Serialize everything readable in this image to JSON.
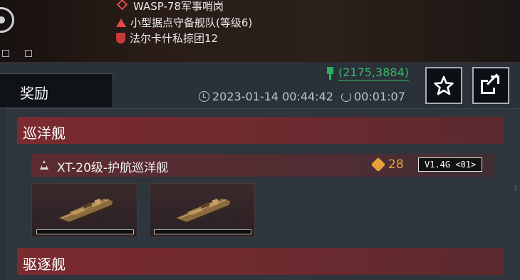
{
  "header": {
    "location_name": "WASP-78军事哨岗",
    "target_name": "小型据点守备舰队(等级6)",
    "faction_name": "法尔卡什私掠团12"
  },
  "reward_tab": {
    "label": "奖励"
  },
  "meta": {
    "coordinates": "(2175,3884)",
    "timestamp": "2023-01-14 00:44:42",
    "duration": "00:01:07"
  },
  "categories": [
    {
      "label": "巡洋舰"
    },
    {
      "label": "驱逐舰"
    }
  ],
  "ship": {
    "name": "XT-20级-护航巡洋舰",
    "cost": "28",
    "version": "V1.4G <01>"
  },
  "icons": {
    "star": "star-icon",
    "share": "share-icon",
    "pin": "map-pin-icon",
    "clock": "clock-icon",
    "timer": "timer-icon",
    "cube": "resource-cube-icon"
  },
  "colors": {
    "coord_green": "#35b96b",
    "category_red": "#7a2b30",
    "cost_orange": "#e8a13a",
    "alert_red": "#e04a48"
  }
}
